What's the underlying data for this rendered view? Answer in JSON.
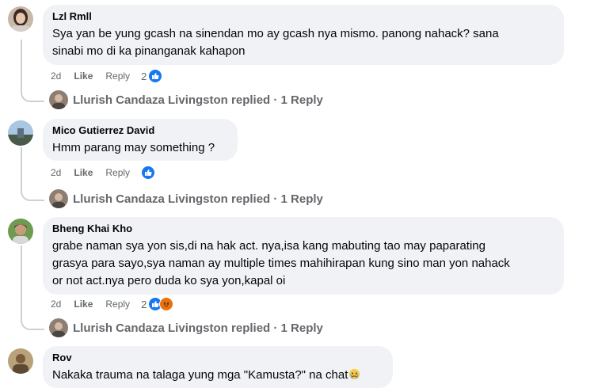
{
  "comments": [
    {
      "author": "Lzl Rmll",
      "lines": [
        "Sya yan be yung gcash na sinendan mo ay gcash nya mismo. panong nahack? sana",
        "sinabi mo di ka pinanganak kahapon"
      ],
      "time": "2d",
      "like_label": "Like",
      "reply_label": "Reply",
      "reaction_count": "2",
      "replied": "Llurish Candaza Livingston replied · 1 Reply"
    },
    {
      "author": "Mico Gutierrez David",
      "lines": [
        "Hmm parang may something ?"
      ],
      "time": "2d",
      "like_label": "Like",
      "reply_label": "Reply",
      "reaction_count": "",
      "replied": "Llurish Candaza Livingston replied · 1 Reply"
    },
    {
      "author": "Bheng Khai Kho",
      "lines": [
        "grabe naman sya yon sis,di na hak act. nya,isa kang mabuting tao may paparating",
        "grasya para sayo,sya naman ay multiple times mahihirapan kung sino man yon nahack",
        "or not act.nya pero duda ko sya yon,kapal oi"
      ],
      "time": "2d",
      "like_label": "Like",
      "reply_label": "Reply",
      "reaction_count": "2",
      "replied": "Llurish Candaza Livingston replied · 1 Reply"
    },
    {
      "author": "Rov",
      "lines": [
        "Nakaka trauma na talaga yung mga \"Kamusta?\" na chat"
      ],
      "time": "",
      "like_label": "",
      "reply_label": "",
      "reaction_count": "",
      "replied": ""
    }
  ],
  "icons": {
    "like_reaction": "thumbs-up-icon",
    "angry_reaction": "angry-face-icon",
    "crying_emoji": "crying-face-icon"
  },
  "colors": {
    "like_blue": "#1877f2",
    "angry_orange": "#e9710f",
    "bubble_bg": "#f0f2f5",
    "meta_gray": "#65676b"
  }
}
